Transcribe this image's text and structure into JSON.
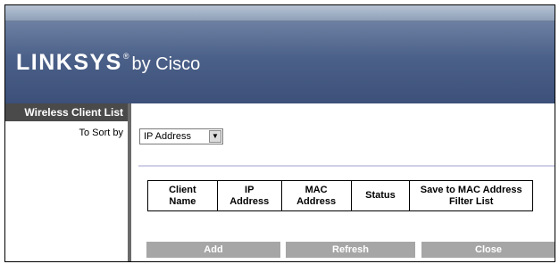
{
  "header": {
    "logo_main": "LINKSYS",
    "logo_reg": "®",
    "logo_sub": "by Cisco"
  },
  "sidebar": {
    "title": "Wireless Client List",
    "sort_label": "To Sort by"
  },
  "sort": {
    "selected": "IP Address"
  },
  "table": {
    "headers": [
      {
        "line1": "Client",
        "line2": "Name"
      },
      {
        "line1": "IP",
        "line2": "Address"
      },
      {
        "line1": "MAC",
        "line2": "Address"
      },
      {
        "line1": "Status",
        "line2": ""
      },
      {
        "line1": "Save to MAC Address",
        "line2": "Filter List"
      }
    ]
  },
  "buttons": {
    "add": "Add",
    "refresh": "Refresh",
    "close": "Close"
  },
  "icons": {
    "dropdown": "chevron-down-icon"
  }
}
